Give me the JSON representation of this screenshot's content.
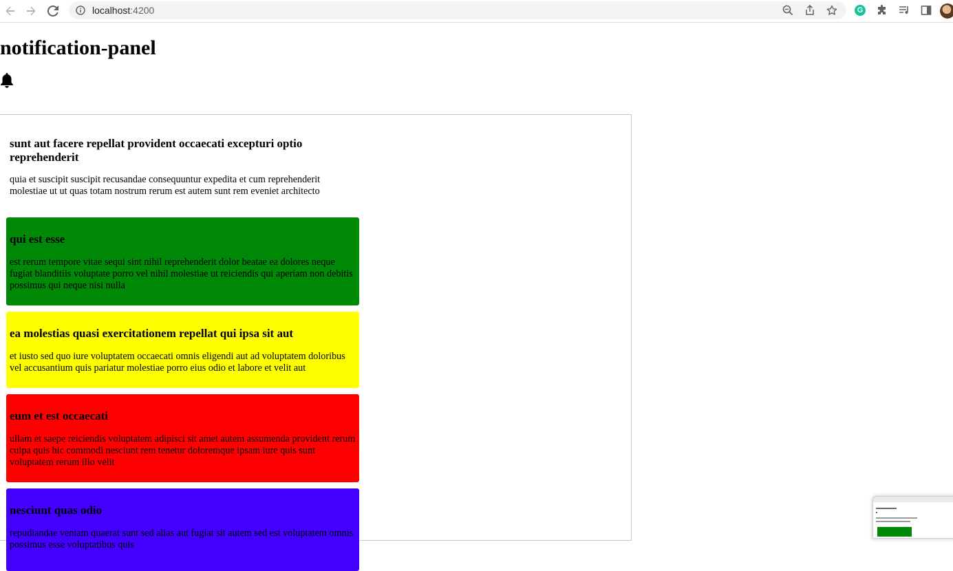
{
  "browser": {
    "url_host": "localhost",
    "url_port": ":4200"
  },
  "page": {
    "title": "notification-panel"
  },
  "notifications": [
    {
      "title": "sunt aut facere repellat provident occaecati excepturi optio reprehenderit",
      "body": "quia et suscipit suscipit recusandae consequuntur expedita et cum reprehenderit molestiae ut ut quas totam nostrum rerum est autem sunt rem eveniet architecto",
      "color": "#ffffff"
    },
    {
      "title": "qui est esse",
      "body": "est rerum tempore vitae sequi sint nihil reprehenderit dolor beatae ea dolores neque fugiat blanditiis voluptate porro vel nihil molestiae ut reiciendis qui aperiam non debitis possimus qui neque nisi nulla",
      "color": "#008807"
    },
    {
      "title": "ea molestias quasi exercitationem repellat qui ipsa sit aut",
      "body": "et iusto sed quo iure voluptatem occaecati omnis eligendi aut ad voluptatem doloribus vel accusantium quis pariatur molestiae porro eius odio et labore et velit aut",
      "color": "#ffff00"
    },
    {
      "title": "eum et est occaecati",
      "body": "ullam et saepe reiciendis voluptatem adipisci sit amet autem assumenda provident rerum culpa quis hic commodi nesciunt rem tenetur doloremque ipsam iure quis sunt voluptatem rerum illo velit",
      "color": "#ff0000"
    },
    {
      "title": "nesciunt quas odio",
      "body": "repudiandae veniam quaerat sunt sed alias aut fugiat sit autem sed est voluptatem omnis possimus esse voluptatibus quis",
      "color": "#4400ff"
    }
  ]
}
